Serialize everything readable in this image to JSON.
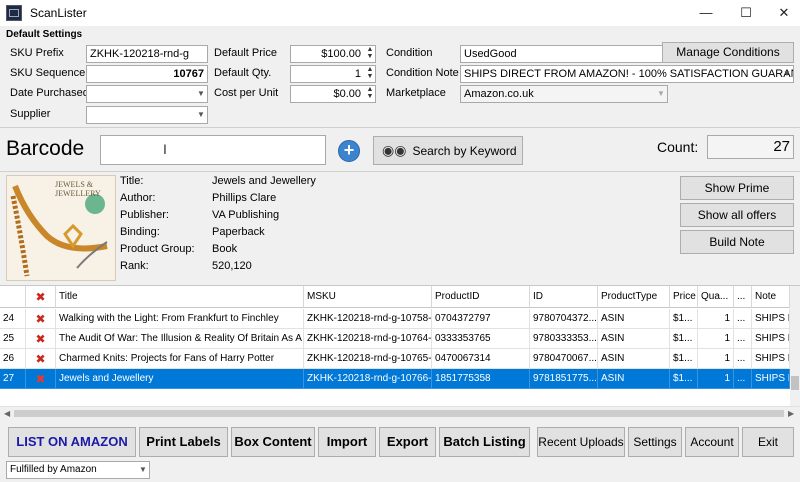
{
  "window": {
    "title": "ScanLister",
    "minimize": "—",
    "maximize": "☐",
    "close": "✕"
  },
  "settings": {
    "heading": "Default Settings",
    "sku_prefix_label": "SKU Prefix",
    "sku_prefix": "ZKHK-120218-rnd-g",
    "sku_sequence_label": "SKU Sequence",
    "sku_sequence": "10767",
    "date_purchased_label": "Date Purchased",
    "date_purchased": "",
    "supplier_label": "Supplier",
    "supplier": "",
    "default_price_label": "Default Price",
    "default_price": "$100.00",
    "default_qty_label": "Default Qty.",
    "default_qty": "1",
    "cost_per_unit_label": "Cost per Unit",
    "cost_per_unit": "$0.00",
    "condition_label": "Condition",
    "condition": "UsedGood",
    "condition_note_label": "Condition Note",
    "condition_note": "SHIPS DIRECT FROM AMAZON! - 100% SATISFACTION GUARAN...",
    "marketplace_label": "Marketplace",
    "marketplace": "Amazon.co.uk",
    "manage_conditions": "Manage Conditions"
  },
  "barcode": {
    "label": "Barcode",
    "value": "",
    "search_keyword": "Search by Keyword",
    "count_label": "Count:",
    "count": "27"
  },
  "product": {
    "cover_title": "JEWELS & JEWELLERY",
    "labels": [
      "Title:",
      "Author:",
      "Publisher:",
      "Binding:",
      "Product Group:",
      "Rank:"
    ],
    "values": [
      "Jewels and Jewellery",
      "Phillips Clare",
      "VA Publishing",
      "Paperback",
      "Book",
      "520,120"
    ],
    "show_prime": "Show Prime",
    "show_all_offers": "Show all offers",
    "build_note": "Build Note"
  },
  "grid": {
    "headers": [
      "",
      "Title",
      "MSKU",
      "ProductID",
      "ID",
      "ProductType",
      "Price",
      "Qua...",
      "...",
      "Note"
    ],
    "rows": [
      {
        "n": "24",
        "title": "Walking with the Light: From Frankfurt to Finchley",
        "msku": "ZKHK-120218-rnd-g-10758-...",
        "pid": "0704372797",
        "id": "9780704372...",
        "ptype": "ASIN",
        "price": "$1...",
        "qty": "1",
        "extra": "...",
        "note": "SHIPS D"
      },
      {
        "n": "25",
        "title": "The Audit Of War: The Illusion & Reality Of Britain As A ...",
        "msku": "ZKHK-120218-rnd-g-10764-...",
        "pid": "0333353765",
        "id": "9780333353...",
        "ptype": "ASIN",
        "price": "$1...",
        "qty": "1",
        "extra": "...",
        "note": "SHIPS D"
      },
      {
        "n": "26",
        "title": "Charmed Knits: Projects for Fans of Harry Potter",
        "msku": "ZKHK-120218-rnd-g-10765-...",
        "pid": "0470067314",
        "id": "9780470067...",
        "ptype": "ASIN",
        "price": "$1...",
        "qty": "1",
        "extra": "...",
        "note": "SHIPS D"
      },
      {
        "n": "27",
        "title": "Jewels and Jewellery",
        "msku": "ZKHK-120218-rnd-g-10766-...",
        "pid": "1851775358",
        "id": "9781851775...",
        "ptype": "ASIN",
        "price": "$1...",
        "qty": "1",
        "extra": "...",
        "note": "SHIPS D"
      }
    ]
  },
  "bottom": {
    "list_on_amazon": "LIST ON AMAZON",
    "print_labels": "Print Labels",
    "box_content": "Box Content",
    "import": "Import",
    "export": "Export",
    "batch_listing": "Batch Listing",
    "recent_uploads": "Recent Uploads",
    "settings": "Settings",
    "account": "Account",
    "exit": "Exit",
    "fulfillment": "Fulfilled by Amazon"
  },
  "colors": {
    "accent": "#0078d7",
    "list_text": "#1a1aa8",
    "delete": "#c8281e"
  }
}
